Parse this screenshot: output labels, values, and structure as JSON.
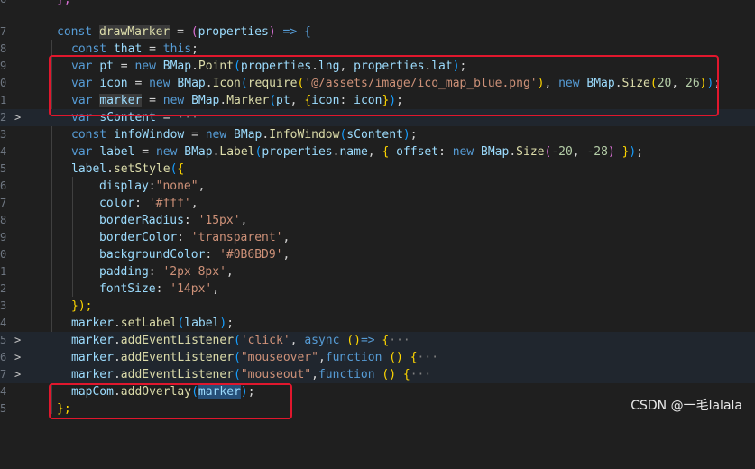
{
  "gutter": [
    "6",
    "7",
    "8",
    "9",
    "0",
    "1",
    "2",
    "3",
    "4",
    "5",
    "6",
    "7",
    "8",
    "9",
    "0",
    "1",
    "2",
    "3",
    "4",
    "5",
    "6",
    "7",
    "8",
    "9",
    "0",
    "4",
    "5"
  ],
  "code": {
    "l0": "},",
    "l1_const": "const",
    "l1_name": "drawMarker",
    "l1_eq": " = ",
    "l1_param": "properties",
    "l1_arrow": " => {",
    "l2_const": "const",
    "l2_that": "that",
    "l2_this": "this",
    "l3_var": "var",
    "l3_pt": "pt",
    "l3_new": "new",
    "l3_bmap": "BMap",
    "l3_point": "Point",
    "l3_props": "properties",
    "l3_lng": "lng",
    "l3_lat": "lat",
    "l4_var": "var",
    "l4_icon": "icon",
    "l4_new": "new",
    "l4_bmap": "BMap",
    "l4_icon_cls": "Icon",
    "l4_require": "require",
    "l4_path": "'@/assets/image/ico_map_blue.png'",
    "l4_new2": "new",
    "l4_size": "Size",
    "l4_w": "20",
    "l4_h": "26",
    "l5_var": "var",
    "l5_marker": "marker",
    "l5_new": "new",
    "l5_bmap": "BMap",
    "l5_cls": "Marker",
    "l5_pt": "pt",
    "l5_icon": "icon",
    "l6_var": "var",
    "l6_scontent": "sContent",
    "l6_ell": "···",
    "l7_const": "const",
    "l7_info": "infoWindow",
    "l7_new": "new",
    "l7_bmap": "BMap",
    "l7_cls": "InfoWindow",
    "l7_arg": "sContent",
    "l8_var": "var",
    "l8_label": "label",
    "l8_new": "new",
    "l8_bmap": "BMap",
    "l8_cls": "Label",
    "l8_props": "properties",
    "l8_name": "name",
    "l8_offset": "offset",
    "l8_new2": "new",
    "l8_size": "Size",
    "l8_x": "-20",
    "l8_y": "-28",
    "l9_label": "label",
    "l9_fn": "setStyle",
    "l10_key": "display",
    "l10_val": "\"none\"",
    "l11_key": "color",
    "l11_val": "'#fff'",
    "l12_key": "borderRadius",
    "l12_val": "'15px'",
    "l13_key": "borderColor",
    "l13_val": "'transparent'",
    "l14_key": "backgroundColor",
    "l14_val": "'#0B6BD9'",
    "l15_key": "padding",
    "l15_val": "'2px 8px'",
    "l16_key": "fontSize",
    "l16_val": "'14px'",
    "l17": "});",
    "l18_marker": "marker",
    "l18_fn": "setLabel",
    "l18_arg": "label",
    "l19_marker": "marker",
    "l19_fn": "addEventListener",
    "l19_evt": "'click'",
    "l19_async": "async",
    "l19_ell": "···",
    "l20_marker": "marker",
    "l20_fn": "addEventListener",
    "l20_evt": "\"mouseover\"",
    "l20_function": "function",
    "l20_ell": "···",
    "l21_marker": "marker",
    "l21_fn": "addEventListener",
    "l21_evt": "\"mouseout\"",
    "l21_function": "function",
    "l21_ell": "···",
    "l22_map": "mapCom",
    "l22_fn": "addOverlay",
    "l22_arg": "marker",
    "l23": "};"
  },
  "watermark": "CSDN @一毛lalala",
  "colors": {
    "background": "#1f1f1f",
    "keyword": "#569cd6",
    "function": "#dcdcaa",
    "variable": "#9cdcfe",
    "string": "#ce9178",
    "number": "#b5cea8",
    "annotation_box": "#e0172d"
  }
}
